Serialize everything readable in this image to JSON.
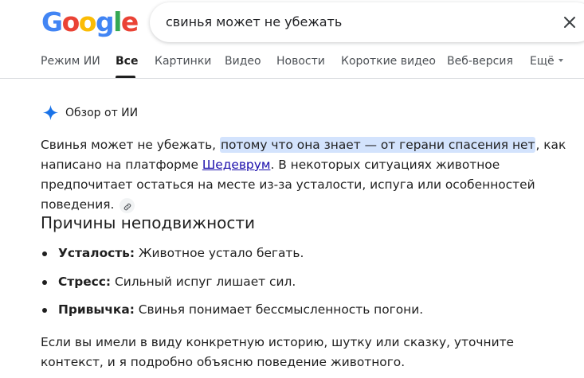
{
  "logo": {
    "letters": [
      "G",
      "o",
      "o",
      "g",
      "l",
      "e"
    ],
    "colors": [
      "#4285F4",
      "#EA4335",
      "#FBBC05",
      "#4285F4",
      "#34A853",
      "#EA4335"
    ]
  },
  "search": {
    "query": "свинья может не убежать",
    "clear_icon": "close-icon"
  },
  "tabs": [
    {
      "label": "Режим ИИ"
    },
    {
      "label": "Все"
    },
    {
      "label": "Картинки"
    },
    {
      "label": "Видео"
    },
    {
      "label": "Новости"
    },
    {
      "label": "Короткие видео"
    },
    {
      "label": "Веб-версия"
    },
    {
      "label": "Ещё"
    }
  ],
  "active_tab": "Все",
  "ai_overview": {
    "label": "Обзор от ИИ",
    "icon": "sparkle-icon",
    "intro": {
      "part1": "Свинья может не убежать, ",
      "highlight": "потому что она знает — от герани спасения нет",
      "part2": ", как написано на платформе ",
      "link": "Шедеврум",
      "part3": ". В некоторых ситуациях животное предпочитает остаться на месте из-за усталости, испуга или особенностей поведения."
    },
    "section_title": "Причины неподвижности",
    "bullets": [
      {
        "term": "Усталость:",
        "text": " Животное устало бегать."
      },
      {
        "term": "Стресс:",
        "text": " Сильный испуг лишает сил."
      },
      {
        "term": "Привычка:",
        "text": " Свинья понимает бессмысленность погони."
      }
    ],
    "outro": "Если вы имели в виду конкретную историю, шутку или сказку, уточните контекст, и я подробно объясню поведение животного."
  },
  "colors": {
    "highlight": "#d3e3fd",
    "link": "#1a0dab",
    "ai_sparkle": "#1a73e8"
  }
}
